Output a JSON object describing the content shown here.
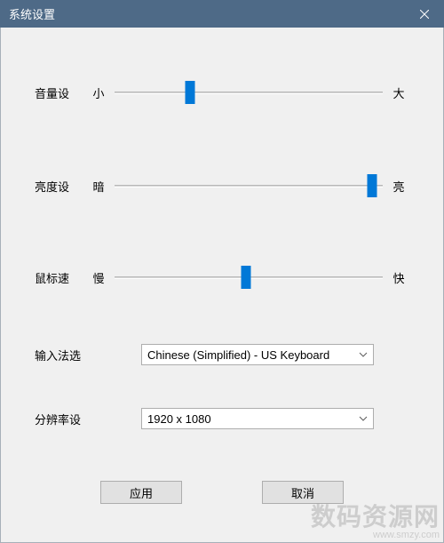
{
  "window": {
    "title": "系统设置"
  },
  "sliders": {
    "volume": {
      "label": "音量设",
      "min_label": "小",
      "max_label": "大",
      "percent": 28
    },
    "brightness": {
      "label": "亮度设",
      "min_label": "暗",
      "max_label": "亮",
      "percent": 96
    },
    "mouse": {
      "label": "鼠标速",
      "min_label": "慢",
      "max_label": "快",
      "percent": 49
    }
  },
  "dropdowns": {
    "ime": {
      "label": "输入法选",
      "value": "Chinese (Simplified) - US Keyboard"
    },
    "resolution": {
      "label": "分辨率设",
      "value": "1920 x 1080"
    }
  },
  "buttons": {
    "apply": "应用",
    "cancel": "取消"
  },
  "watermark": {
    "main": "数码资源网",
    "sub": "www.smzy.com"
  }
}
